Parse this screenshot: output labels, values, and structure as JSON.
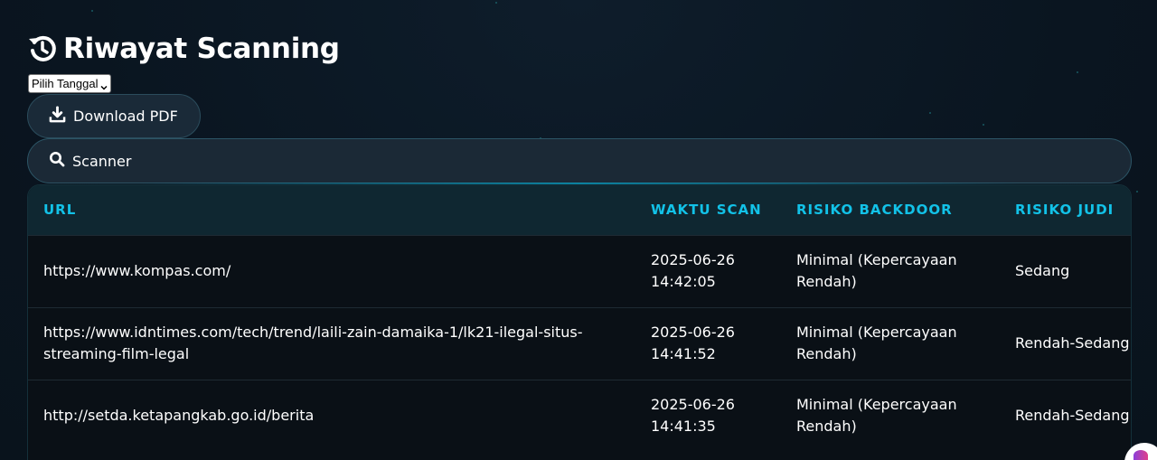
{
  "header": {
    "title": "Riwayat Scanning",
    "icon": "history-icon"
  },
  "date_filter": {
    "selected": "Pilih Tanggal"
  },
  "download_button": {
    "label": "Download PDF",
    "icon": "download-icon"
  },
  "search": {
    "label": "Scanner",
    "icon": "search-icon"
  },
  "table": {
    "columns": [
      "URL",
      "WAKTU SCAN",
      "RISIKO BACKDOOR",
      "RISIKO JUDI"
    ],
    "rows": [
      {
        "url": "https://www.kompas.com/",
        "date": "2025-06-26",
        "time": "14:42:05",
        "backdoor": "Minimal (Kepercayaan Rendah)",
        "judi": "Sedang"
      },
      {
        "url": "https://www.idntimes.com/tech/trend/laili-zain-damaika-1/lk21-ilegal-situs-streaming-film-legal",
        "date": "2025-06-26",
        "time": "14:41:52",
        "backdoor": "Minimal (Kepercayaan Rendah)",
        "judi": "Rendah-Sedang"
      },
      {
        "url": "http://setda.ketapangkab.go.id/berita",
        "date": "2025-06-26",
        "time": "14:41:35",
        "backdoor": "Minimal (Kepercayaan Rendah)",
        "judi": "Rendah-Sedang"
      }
    ]
  },
  "colors": {
    "background": "#0b1622",
    "accent": "#12c2e8",
    "header_row": "#0f2731"
  }
}
